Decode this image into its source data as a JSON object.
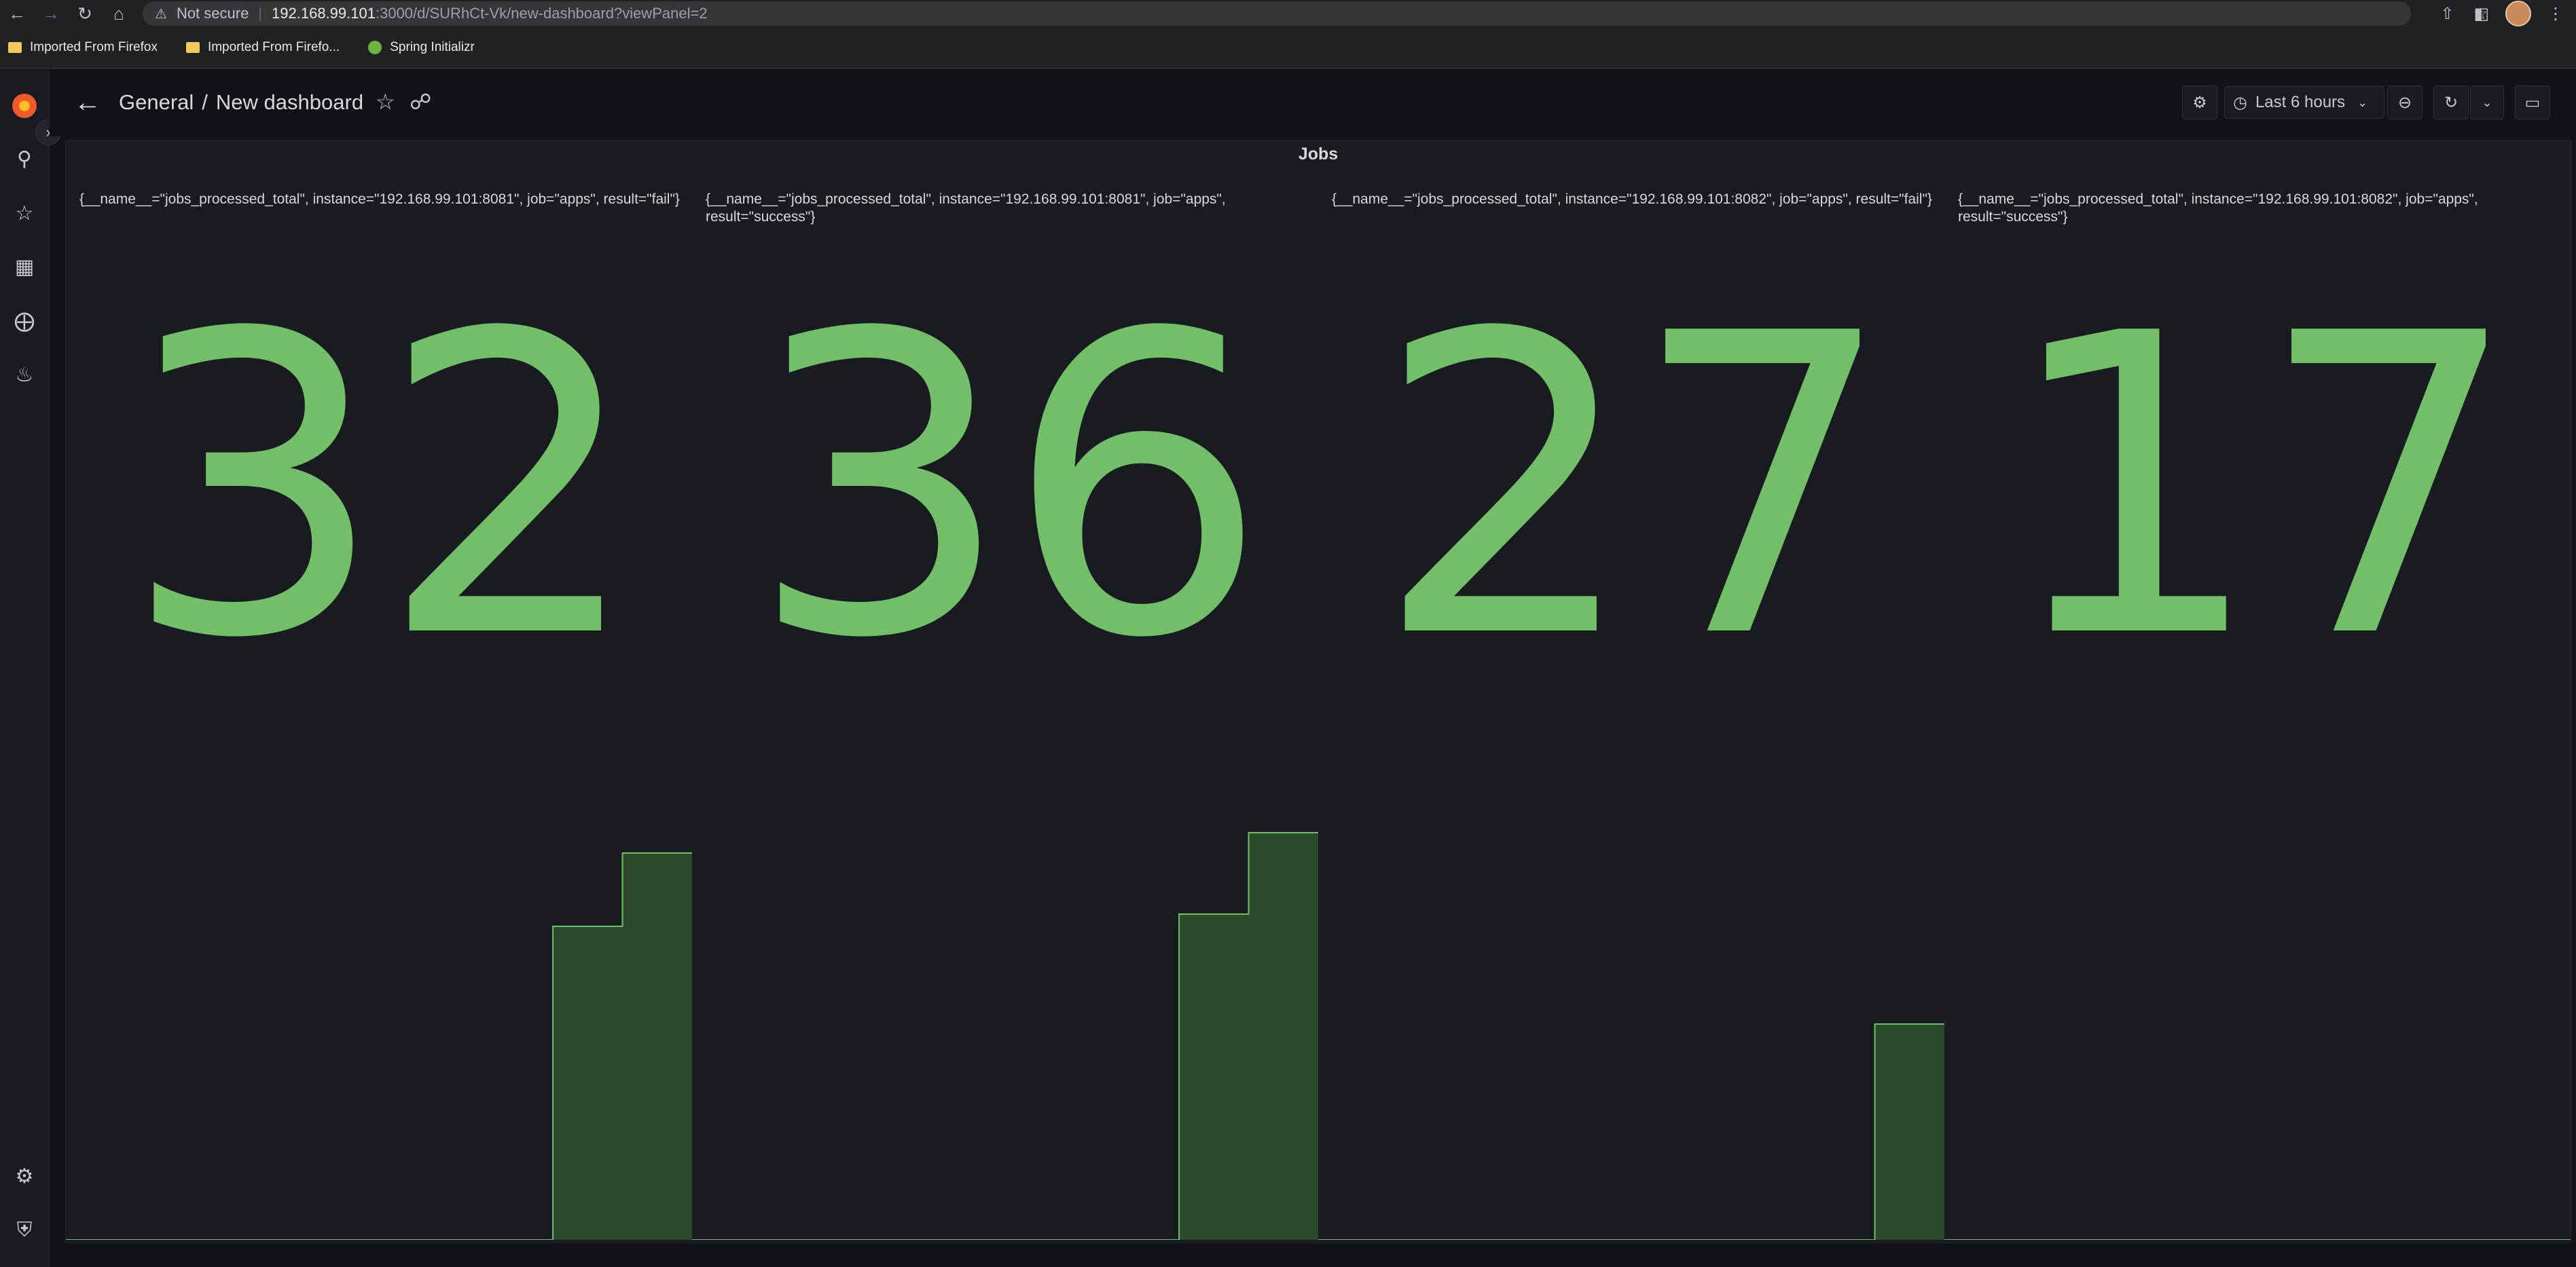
{
  "browser": {
    "security_label": "Not secure",
    "url_host": "192.168.99.101",
    "url_path": ":3000/d/SURhCt-Vk/new-dashboard?viewPanel=2",
    "bookmarks": [
      {
        "label": "Imported From Firefox",
        "icon": "folder-icon"
      },
      {
        "label": "Imported From Firefo...",
        "icon": "folder-icon"
      },
      {
        "label": "Spring Initializr",
        "icon": "spring-icon"
      }
    ]
  },
  "topnav": {
    "breadcrumb_folder": "General",
    "breadcrumb_separator": "/",
    "breadcrumb_dashboard": "New dashboard",
    "time_range": "Last 6 hours"
  },
  "panel": {
    "title": "Jobs",
    "stats": [
      {
        "label": "{__name__=\"jobs_processed_total\", instance=\"192.168.99.101:8081\", job=\"apps\", result=\"fail\"}",
        "value": "32",
        "spark": [
          0,
          0,
          0,
          0,
          0,
          0,
          0,
          0.77,
          0.95
        ]
      },
      {
        "label": "{__name__=\"jobs_processed_total\", instance=\"192.168.99.101:8081\", job=\"apps\", result=\"success\"}",
        "value": "36",
        "spark": [
          0,
          0,
          0,
          0,
          0,
          0,
          0,
          0.8,
          1.0
        ]
      },
      {
        "label": "{__name__=\"jobs_processed_total\", instance=\"192.168.99.101:8082\", job=\"apps\", result=\"fail\"}",
        "value": "27",
        "spark": [
          0,
          0,
          0,
          0,
          0,
          0,
          0,
          0,
          0.53
        ]
      },
      {
        "label": "{__name__=\"jobs_processed_total\", instance=\"192.168.99.101:8082\", job=\"apps\", result=\"success\"}",
        "value": "17",
        "spark": [
          0,
          0,
          0,
          0,
          0,
          0,
          0,
          0,
          0
        ]
      }
    ]
  },
  "colors": {
    "stat_green": "#73bf69",
    "spark_fill": "#2a4a2b",
    "background": "#111217",
    "panel": "#181b1f"
  }
}
